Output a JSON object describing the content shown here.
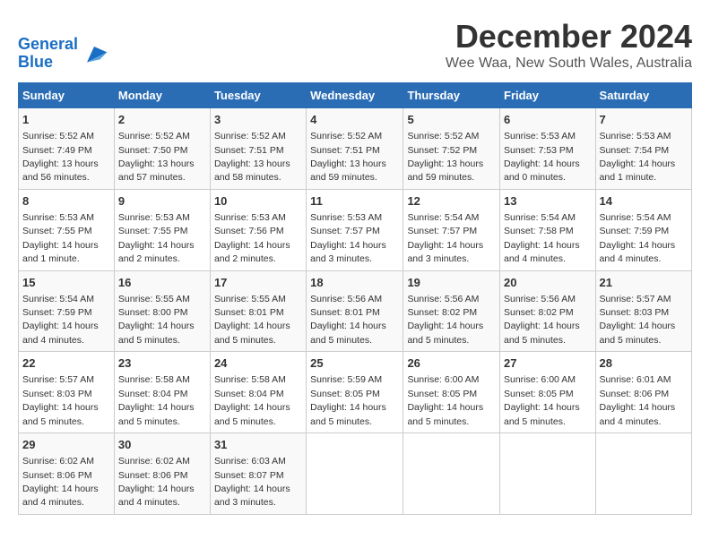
{
  "logo": {
    "line1": "General",
    "line2": "Blue"
  },
  "title": "December 2024",
  "location": "Wee Waa, New South Wales, Australia",
  "days_of_week": [
    "Sunday",
    "Monday",
    "Tuesday",
    "Wednesday",
    "Thursday",
    "Friday",
    "Saturday"
  ],
  "weeks": [
    [
      {
        "day": "1",
        "sunrise": "5:52 AM",
        "sunset": "7:49 PM",
        "daylight": "13 hours and 56 minutes."
      },
      {
        "day": "2",
        "sunrise": "5:52 AM",
        "sunset": "7:50 PM",
        "daylight": "13 hours and 57 minutes."
      },
      {
        "day": "3",
        "sunrise": "5:52 AM",
        "sunset": "7:51 PM",
        "daylight": "13 hours and 58 minutes."
      },
      {
        "day": "4",
        "sunrise": "5:52 AM",
        "sunset": "7:51 PM",
        "daylight": "13 hours and 59 minutes."
      },
      {
        "day": "5",
        "sunrise": "5:52 AM",
        "sunset": "7:52 PM",
        "daylight": "13 hours and 59 minutes."
      },
      {
        "day": "6",
        "sunrise": "5:53 AM",
        "sunset": "7:53 PM",
        "daylight": "14 hours and 0 minutes."
      },
      {
        "day": "7",
        "sunrise": "5:53 AM",
        "sunset": "7:54 PM",
        "daylight": "14 hours and 1 minute."
      }
    ],
    [
      {
        "day": "8",
        "sunrise": "5:53 AM",
        "sunset": "7:55 PM",
        "daylight": "14 hours and 1 minute."
      },
      {
        "day": "9",
        "sunrise": "5:53 AM",
        "sunset": "7:55 PM",
        "daylight": "14 hours and 2 minutes."
      },
      {
        "day": "10",
        "sunrise": "5:53 AM",
        "sunset": "7:56 PM",
        "daylight": "14 hours and 2 minutes."
      },
      {
        "day": "11",
        "sunrise": "5:53 AM",
        "sunset": "7:57 PM",
        "daylight": "14 hours and 3 minutes."
      },
      {
        "day": "12",
        "sunrise": "5:54 AM",
        "sunset": "7:57 PM",
        "daylight": "14 hours and 3 minutes."
      },
      {
        "day": "13",
        "sunrise": "5:54 AM",
        "sunset": "7:58 PM",
        "daylight": "14 hours and 4 minutes."
      },
      {
        "day": "14",
        "sunrise": "5:54 AM",
        "sunset": "7:59 PM",
        "daylight": "14 hours and 4 minutes."
      }
    ],
    [
      {
        "day": "15",
        "sunrise": "5:54 AM",
        "sunset": "7:59 PM",
        "daylight": "14 hours and 4 minutes."
      },
      {
        "day": "16",
        "sunrise": "5:55 AM",
        "sunset": "8:00 PM",
        "daylight": "14 hours and 5 minutes."
      },
      {
        "day": "17",
        "sunrise": "5:55 AM",
        "sunset": "8:01 PM",
        "daylight": "14 hours and 5 minutes."
      },
      {
        "day": "18",
        "sunrise": "5:56 AM",
        "sunset": "8:01 PM",
        "daylight": "14 hours and 5 minutes."
      },
      {
        "day": "19",
        "sunrise": "5:56 AM",
        "sunset": "8:02 PM",
        "daylight": "14 hours and 5 minutes."
      },
      {
        "day": "20",
        "sunrise": "5:56 AM",
        "sunset": "8:02 PM",
        "daylight": "14 hours and 5 minutes."
      },
      {
        "day": "21",
        "sunrise": "5:57 AM",
        "sunset": "8:03 PM",
        "daylight": "14 hours and 5 minutes."
      }
    ],
    [
      {
        "day": "22",
        "sunrise": "5:57 AM",
        "sunset": "8:03 PM",
        "daylight": "14 hours and 5 minutes."
      },
      {
        "day": "23",
        "sunrise": "5:58 AM",
        "sunset": "8:04 PM",
        "daylight": "14 hours and 5 minutes."
      },
      {
        "day": "24",
        "sunrise": "5:58 AM",
        "sunset": "8:04 PM",
        "daylight": "14 hours and 5 minutes."
      },
      {
        "day": "25",
        "sunrise": "5:59 AM",
        "sunset": "8:05 PM",
        "daylight": "14 hours and 5 minutes."
      },
      {
        "day": "26",
        "sunrise": "6:00 AM",
        "sunset": "8:05 PM",
        "daylight": "14 hours and 5 minutes."
      },
      {
        "day": "27",
        "sunrise": "6:00 AM",
        "sunset": "8:05 PM",
        "daylight": "14 hours and 5 minutes."
      },
      {
        "day": "28",
        "sunrise": "6:01 AM",
        "sunset": "8:06 PM",
        "daylight": "14 hours and 4 minutes."
      }
    ],
    [
      {
        "day": "29",
        "sunrise": "6:02 AM",
        "sunset": "8:06 PM",
        "daylight": "14 hours and 4 minutes."
      },
      {
        "day": "30",
        "sunrise": "6:02 AM",
        "sunset": "8:06 PM",
        "daylight": "14 hours and 4 minutes."
      },
      {
        "day": "31",
        "sunrise": "6:03 AM",
        "sunset": "8:07 PM",
        "daylight": "14 hours and 3 minutes."
      },
      null,
      null,
      null,
      null
    ]
  ]
}
